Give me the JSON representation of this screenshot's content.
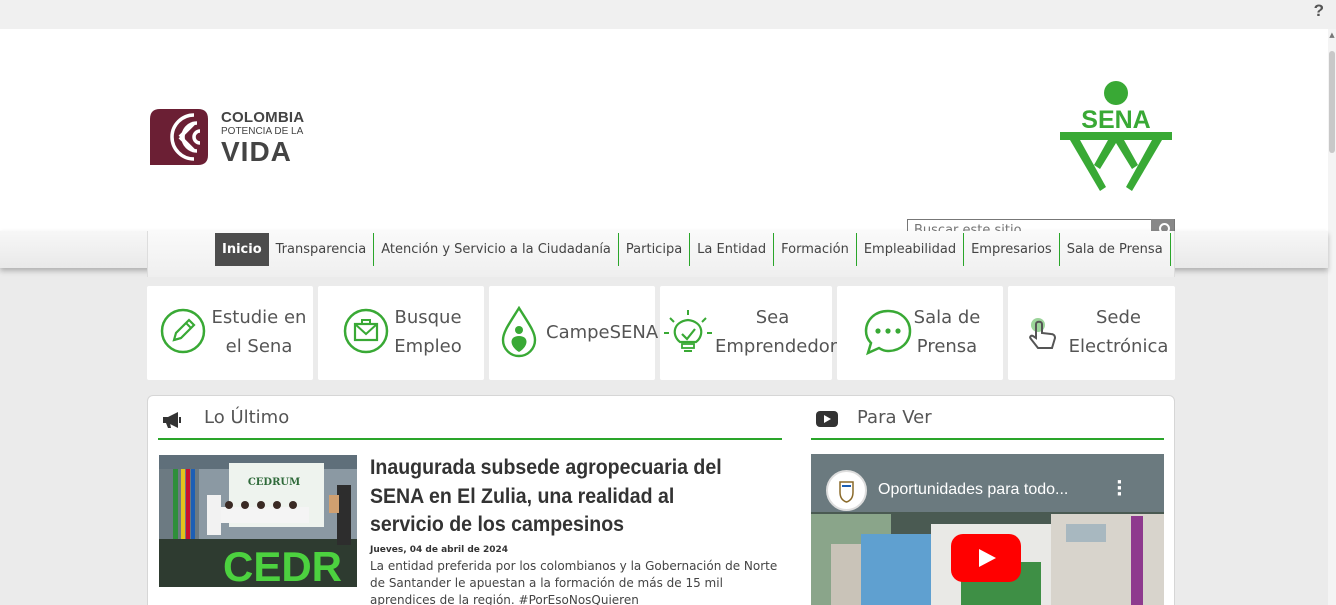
{
  "header": {
    "help_icon": "?",
    "colombia_logo": {
      "line1": "COLOMBIA",
      "line2": "POTENCIA DE LA",
      "line3": "VIDA"
    },
    "sena_logo": {
      "text": "SENA",
      "color": "#39a935"
    },
    "search": {
      "placeholder": "Buscar este sitio",
      "icon": "search-icon"
    }
  },
  "nav": {
    "items": [
      {
        "label": "Inicio",
        "active": true
      },
      {
        "label": "Transparencia"
      },
      {
        "label": "Atención y Servicio a la Ciudadanía"
      },
      {
        "label": "Participa"
      },
      {
        "label": "La Entidad"
      },
      {
        "label": "Formación"
      },
      {
        "label": "Empleabilidad"
      },
      {
        "label": "Empresarios"
      },
      {
        "label": "Sala de Prensa"
      }
    ]
  },
  "tiles": [
    {
      "line1": "Estudie en",
      "line2": "el Sena",
      "icon": "pencil-icon"
    },
    {
      "line1": "Busque",
      "line2": "Empleo",
      "icon": "briefcase-icon"
    },
    {
      "line1": "CampeSENA",
      "line2": "",
      "icon": "campesena-drop-icon"
    },
    {
      "line1": "Sea",
      "line2": "Emprendedor",
      "icon": "lightbulb-icon"
    },
    {
      "line1": "Sala de",
      "line2": "Prensa",
      "icon": "chat-bubble-icon"
    },
    {
      "line1": "Sede",
      "line2": "Electrónica",
      "icon": "touch-hand-icon"
    }
  ],
  "latest": {
    "title": "Lo Último",
    "icon": "megaphone-icon",
    "article": {
      "headline": "Inaugurada subsede agropecuaria del SENA en El Zulia, una realidad al servicio de los campesinos",
      "date": "Jueves, 04 de abril de 2024",
      "summary": "La entidad preferida por los colombianos y la Gobernación de Norte de Santander le apuestan a la formación de más de 15 mil aprendices de la región. #PorEsoNosQuieren",
      "image_sign": "CEDRUM",
      "image_letters": "CEDR"
    }
  },
  "watch": {
    "title": "Para Ver",
    "icon": "youtube-play-icon",
    "video_title": "Oportunidades para todo...",
    "menu_icon": "more-vert-icon"
  },
  "colors": {
    "green": "#39a935",
    "nav_active": "#4d4d4d",
    "colombia_maroon": "#6b1f34",
    "youtube_red": "#ff0000"
  }
}
